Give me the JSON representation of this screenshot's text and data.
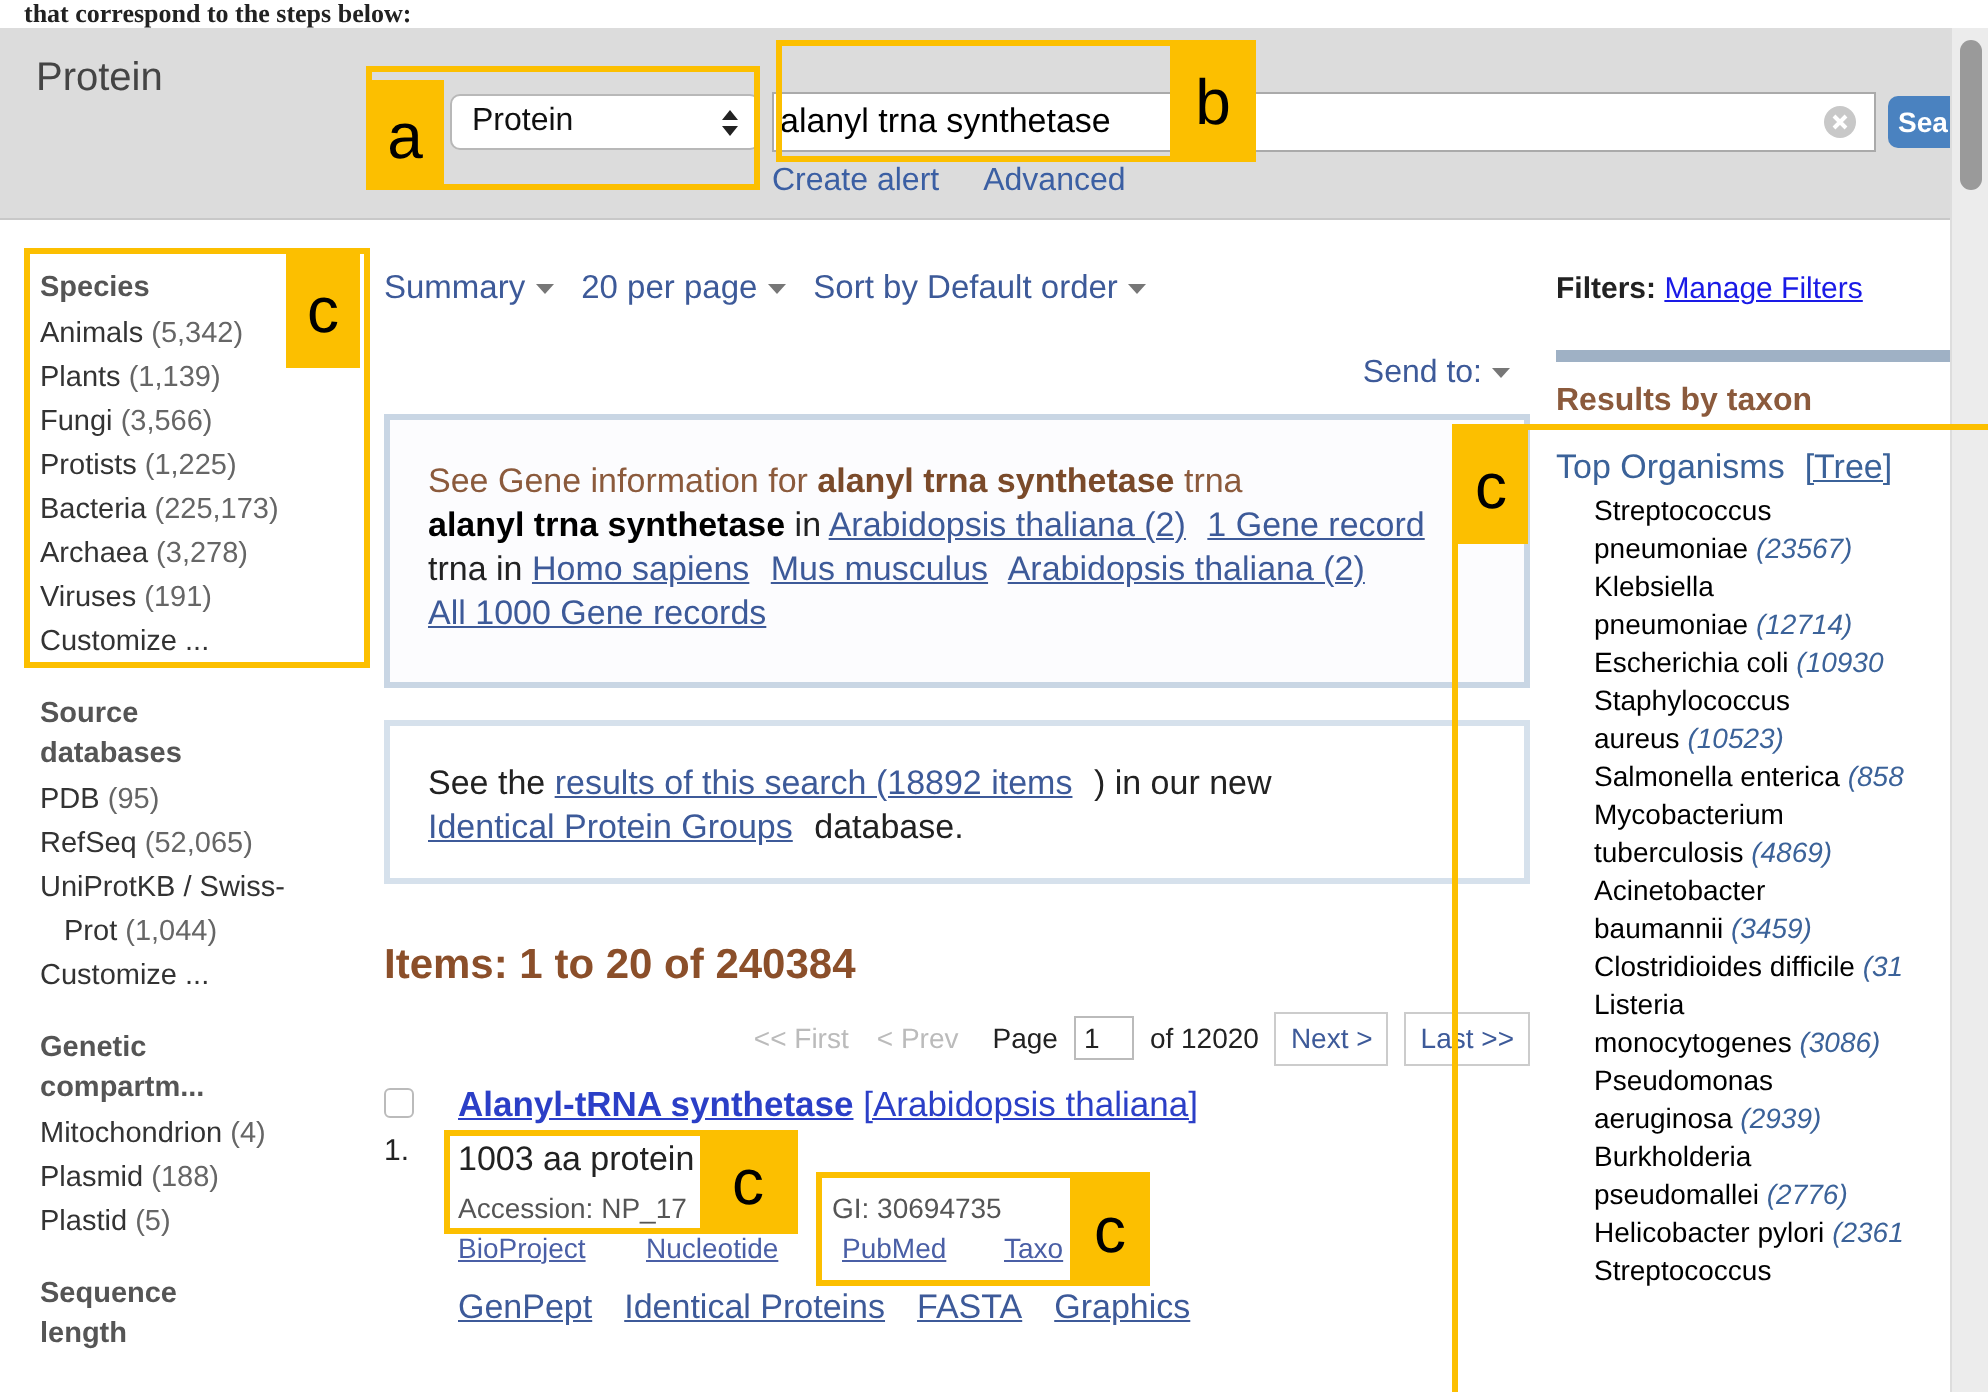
{
  "caption": "that correspond to the steps below:",
  "header": {
    "title": "Protein",
    "database": "Protein",
    "query": "alanyl trna synthetase",
    "links": [
      "Create alert",
      "Advanced"
    ],
    "search_button": "Sea"
  },
  "sidebar": [
    {
      "title": "Species",
      "items": [
        {
          "name": "Animals",
          "count": "(5,342)"
        },
        {
          "name": "Plants",
          "count": "(1,139)"
        },
        {
          "name": "Fungi",
          "count": "(3,566)"
        },
        {
          "name": "Protists",
          "count": "(1,225)"
        },
        {
          "name": "Bacteria",
          "count": "(225,173)"
        },
        {
          "name": "Archaea",
          "count": "(3,278)"
        },
        {
          "name": "Viruses",
          "count": "(191)"
        },
        {
          "name": "Customize ..."
        }
      ]
    },
    {
      "title": "Source databases",
      "items": [
        {
          "name": "PDB",
          "count": "(95)"
        },
        {
          "name": "RefSeq",
          "count": "(52,065)"
        },
        {
          "name": "UniProtKB / Swiss-Prot",
          "count": "(1,044)"
        },
        {
          "name": "Customize ..."
        }
      ]
    },
    {
      "title": "Genetic compartm...",
      "items": [
        {
          "name": "Mitochondrion",
          "count": "(4)"
        },
        {
          "name": "Plasmid",
          "count": "(188)"
        },
        {
          "name": "Plastid",
          "count": "(5)"
        }
      ]
    },
    {
      "title": "Sequence length"
    }
  ],
  "toolbar": {
    "menus": [
      "Summary",
      "20 per page",
      "Sort by Default order"
    ],
    "send_to": "Send to:"
  },
  "gene_box": [
    [
      {
        "kind": "heading",
        "text": "See Gene information for "
      },
      {
        "kind": "heading_bold",
        "text": "alanyl trna synthetase"
      },
      {
        "kind": "heading",
        "text": " trna"
      }
    ],
    [
      {
        "kind": "bold",
        "text": "alanyl trna synthetase"
      },
      {
        "kind": "plain",
        "text": " in "
      },
      {
        "kind": "link",
        "text": "Arabidopsis thaliana (2)"
      },
      {
        "kind": "link",
        "text": "1 Gene record"
      },
      {
        "kind": "plain",
        "text": " trna in "
      },
      {
        "kind": "link",
        "text": "Homo sapiens"
      },
      {
        "kind": "link",
        "text": "Mus musculus"
      },
      {
        "kind": "link",
        "text": "Arabidopsis thaliana (2)"
      },
      {
        "kind": "link",
        "text": "All 1000 Gene records"
      }
    ]
  ],
  "ipg_box": [
    {
      "kind": "plain",
      "text": "See the "
    },
    {
      "kind": "link",
      "text": "results of this search (18892 items"
    },
    {
      "kind": "plain",
      "text": ") in our new "
    },
    {
      "kind": "link",
      "text": "Identical Protein Groups"
    },
    {
      "kind": "plain",
      "text": " database."
    }
  ],
  "results_heading": "Items: 1 to 20 of 240384",
  "pager": {
    "before": [
      {
        "label": "<< First",
        "disabled": true
      },
      {
        "label": "< Prev",
        "disabled": true
      }
    ],
    "page_label": "Page",
    "page": "1",
    "total": "of 12020",
    "after": [
      {
        "label": "Next >",
        "disabled": false
      },
      {
        "label": "Last >>",
        "disabled": false
      }
    ]
  },
  "result": {
    "checked": false,
    "number": "1.",
    "title": "Alanyl-tRNA synthetase",
    "organism": "[Arabidopsis thaliana]",
    "description": "1003 aa protein",
    "accession": "Accession: NP_17",
    "gi": "GI: 30694735",
    "links_1": [
      "BioProject",
      "Nucleotide",
      "PubMed",
      "Taxo"
    ],
    "links_2": [
      "GenPept",
      "Identical Proteins",
      "FASTA",
      "Graphics"
    ]
  },
  "filters": {
    "label": "Filters:",
    "link": "Manage Filters"
  },
  "taxon": {
    "title": "Results by taxon",
    "top": "Top Organisms",
    "tree": "[Tree]",
    "organisms": [
      {
        "name": "Streptococcus pneumoniae",
        "count": "(23567)"
      },
      {
        "name": "Klebsiella pneumoniae",
        "count": "(12714)"
      },
      {
        "name": "Escherichia coli",
        "count": "(10930"
      },
      {
        "name": "Staphylococcus aureus",
        "count": "(10523)"
      },
      {
        "name": "Salmonella enterica",
        "count": "(858"
      },
      {
        "name": "Mycobacterium tuberculosis",
        "count": "(4869)"
      },
      {
        "name": "Acinetobacter baumannii",
        "count": "(3459)"
      },
      {
        "name": "Clostridioides difficile",
        "count": "(31"
      },
      {
        "name": "Listeria monocytogenes",
        "count": "(3086)"
      },
      {
        "name": "Pseudomonas aeruginosa",
        "count": "(2939)"
      },
      {
        "name": "Burkholderia pseudomallei",
        "count": "(2776)"
      },
      {
        "name": "Helicobacter pylori",
        "count": "(2361"
      },
      {
        "name": "Streptococcus"
      }
    ]
  },
  "annotations": [
    {
      "label": "a"
    },
    {
      "label": "b"
    },
    {
      "label": "c"
    },
    {
      "label": "c"
    },
    {
      "label": "c"
    },
    {
      "label": "c"
    }
  ]
}
